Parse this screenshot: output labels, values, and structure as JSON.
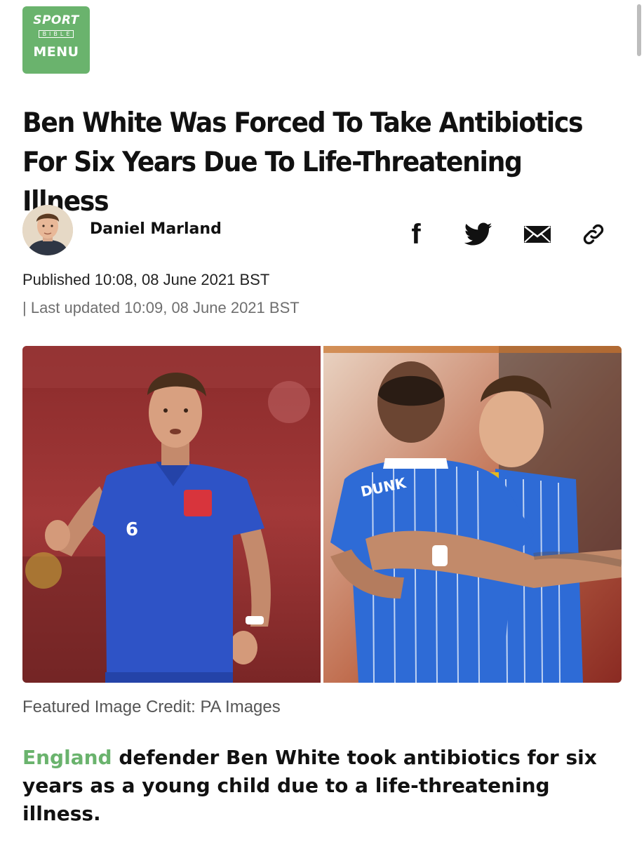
{
  "logo": {
    "brand_top": "SPORT",
    "brand_sub": "BIBLE",
    "menu_label": "MENU",
    "brand_color": "#6ab36d"
  },
  "article": {
    "headline": "Ben White Was Forced To Take Antibiotics For Six Years Due To Life-Threatening Illness",
    "author": "Daniel Marland",
    "published": "Published 10:08, 08 June 2021 BST",
    "updated": "| Last updated 10:09, 08 June 2021 BST",
    "image_credit": "Featured Image Credit: PA Images",
    "lede_link": "England",
    "lede_rest": " defender Ben White took antibiotics for six years as a young child due to a life-threatening illness."
  },
  "share_icons": [
    "facebook-icon",
    "twitter-icon",
    "email-icon",
    "link-icon"
  ],
  "featured_photos": {
    "left_shirt_number": "6",
    "right_shirt_name": "DUNK"
  }
}
